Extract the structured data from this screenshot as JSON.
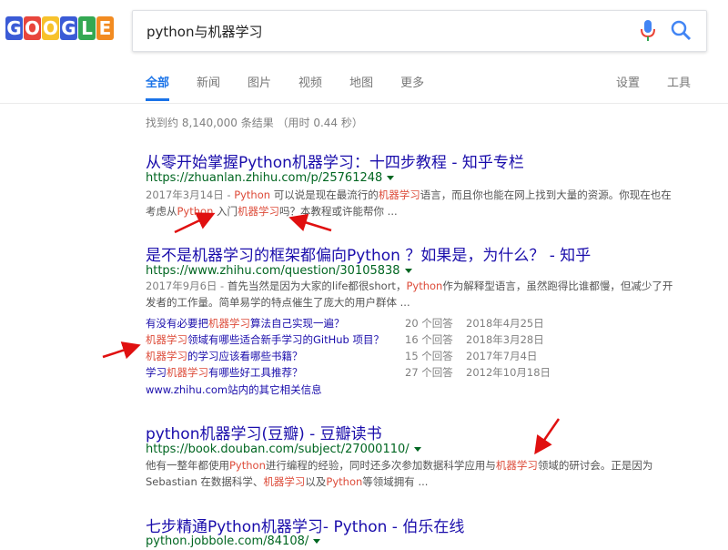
{
  "logo": {
    "letters": [
      "G",
      "O",
      "O",
      "G",
      "L",
      "E"
    ],
    "colors": [
      "#3b5bd6",
      "#e8453c",
      "#f7c22c",
      "#3b5bd6",
      "#34a853",
      "#f28b21"
    ]
  },
  "search": {
    "query": "python与机器学习"
  },
  "tabs": [
    "全部",
    "新闻",
    "图片",
    "视频",
    "地图",
    "更多"
  ],
  "tools": [
    "设置",
    "工具"
  ],
  "stats": "找到约 8,140,000 条结果 （用时 0.44 秒）",
  "results": [
    {
      "title": "从零开始掌握Python机器学习：十四步教程 - 知乎专栏",
      "url": "https://zhuanlan.zhihu.com/p/25761248",
      "snippet_parts": [
        {
          "t": "2017年3月14日 - ",
          "c": "date"
        },
        {
          "t": "Python",
          "c": "hl"
        },
        {
          "t": " 可以说是现在最流行的"
        },
        {
          "t": "机器学习",
          "c": "hl"
        },
        {
          "t": "语言，而且你也能在网上找到大量的资源。你现在也在考虑从"
        },
        {
          "t": "Python",
          "c": "hl"
        },
        {
          "t": " 入门"
        },
        {
          "t": "机器学习",
          "c": "hl"
        },
        {
          "t": "吗？本教程或许能帮你 ..."
        }
      ]
    },
    {
      "title": "是不是机器学习的框架都偏向Python ？如果是，为什么？ - 知乎",
      "url": "https://www.zhihu.com/question/30105838",
      "snippet_parts": [
        {
          "t": "2017年9月6日 - ",
          "c": "date"
        },
        {
          "t": "首先当然是因为大家的life都很short，"
        },
        {
          "t": "Python",
          "c": "hl"
        },
        {
          "t": "作为解释型语言，虽然跑得比谁都慢，但减少了开发者的工作量。简单易学的特点催生了庞大的用户群体 ..."
        }
      ],
      "sub": [
        {
          "q_pre": "有没有必要把",
          "q_hl": "机器学习",
          "q_post": "算法自己实现一遍？",
          "answers": "20 个回答",
          "date": "2018年4月25日"
        },
        {
          "q_pre": "",
          "q_hl": "机器学习",
          "q_post": "领域有哪些适合新手学习的GitHub 项目？",
          "answers": "16 个回答",
          "date": "2018年3月28日"
        },
        {
          "q_pre": "",
          "q_hl": "机器学习",
          "q_post": "的学习应该看哪些书籍？",
          "answers": "15 个回答",
          "date": "2017年7月4日"
        },
        {
          "q_pre": "学习",
          "q_hl": "机器学习",
          "q_post": "有哪些好工具推荐？",
          "answers": "27 个回答",
          "date": "2012年10月18日"
        }
      ],
      "more": "www.zhihu.com站内的其它相关信息"
    },
    {
      "title": "python机器学习(豆瓣) - 豆瓣读书",
      "url": "https://book.douban.com/subject/27000110/",
      "snippet_parts": [
        {
          "t": "他有一整年都使用"
        },
        {
          "t": "Python",
          "c": "hl"
        },
        {
          "t": "进行编程的经验，同时还多次参加数据科学应用与"
        },
        {
          "t": "机器学习",
          "c": "hl"
        },
        {
          "t": "领域的研讨会。正是因为Sebastian 在数据科学、"
        },
        {
          "t": "机器学习",
          "c": "hl"
        },
        {
          "t": "以及"
        },
        {
          "t": "Python",
          "c": "hl"
        },
        {
          "t": "等领域拥有 ..."
        }
      ]
    },
    {
      "title": "七步精通Python机器学习- Python - 伯乐在线",
      "url": "python.jobbole.com/84108/"
    }
  ]
}
